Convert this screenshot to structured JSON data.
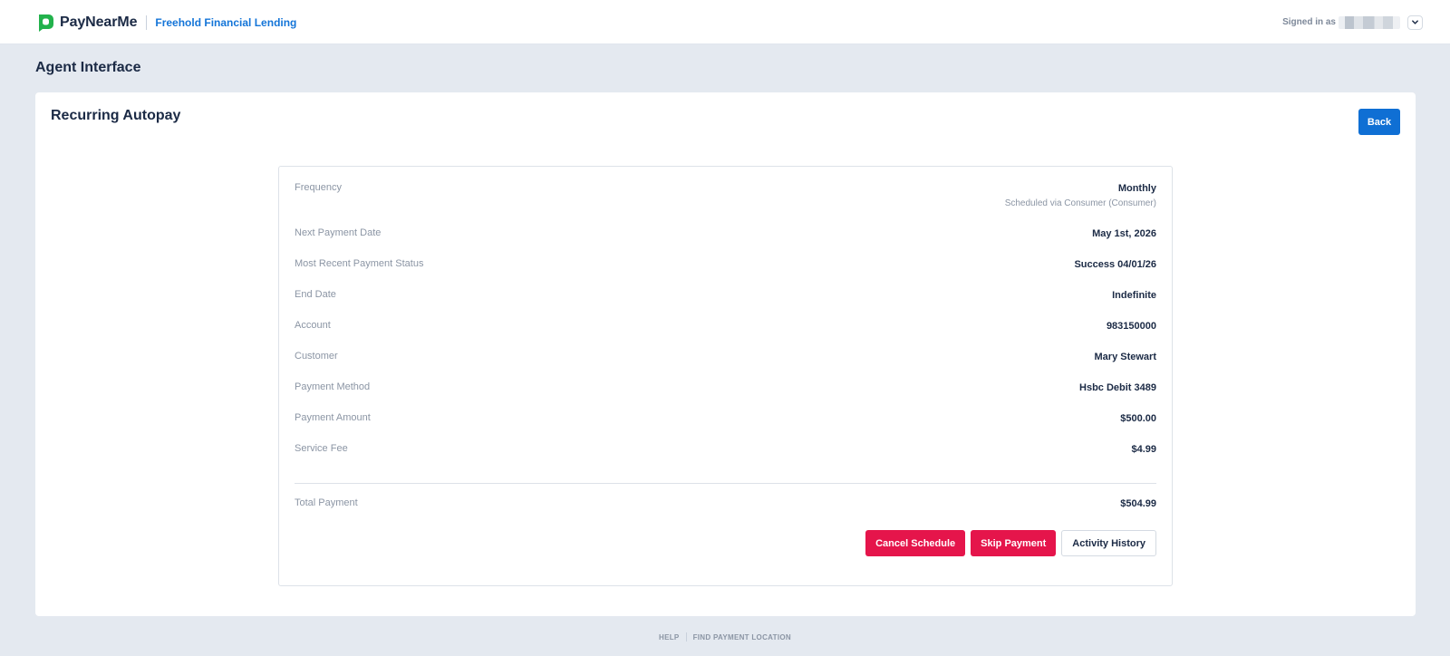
{
  "header": {
    "brand_name": "PayNearMe",
    "lender_name": "Freehold Financial Lending",
    "signed_in_label": "Signed in as",
    "logo_icon": "paynearme-logo-icon",
    "dropdown_icon": "chevron-down-icon"
  },
  "page": {
    "title": "Agent Interface"
  },
  "card": {
    "title": "Recurring Autopay",
    "back_label": "Back"
  },
  "details": {
    "rows": [
      {
        "label": "Frequency",
        "value": "Monthly",
        "sub": "Scheduled via Consumer (Consumer)"
      },
      {
        "label": "Next Payment Date",
        "value": "May 1st, 2026"
      },
      {
        "label": "Most Recent Payment Status",
        "value": "Success 04/01/26"
      },
      {
        "label": "End Date",
        "value": "Indefinite"
      },
      {
        "label": "Account",
        "value": "983150000"
      },
      {
        "label": "Customer",
        "value": "Mary Stewart"
      },
      {
        "label": "Payment Method",
        "value": "Hsbc Debit 3489"
      },
      {
        "label": "Payment Amount",
        "value": "$500.00"
      },
      {
        "label": "Service Fee",
        "value": "$4.99"
      }
    ],
    "total": {
      "label": "Total Payment",
      "value": "$504.99"
    }
  },
  "actions": {
    "cancel_label": "Cancel Schedule",
    "skip_label": "Skip Payment",
    "history_label": "Activity History"
  },
  "footer": {
    "help_label": "HELP",
    "find_label": "FIND PAYMENT LOCATION"
  },
  "colors": {
    "brand_green": "#22b24c",
    "primary_blue": "#0f6fd4",
    "danger_red": "#e5154b",
    "page_bg": "#e4e9f0"
  }
}
